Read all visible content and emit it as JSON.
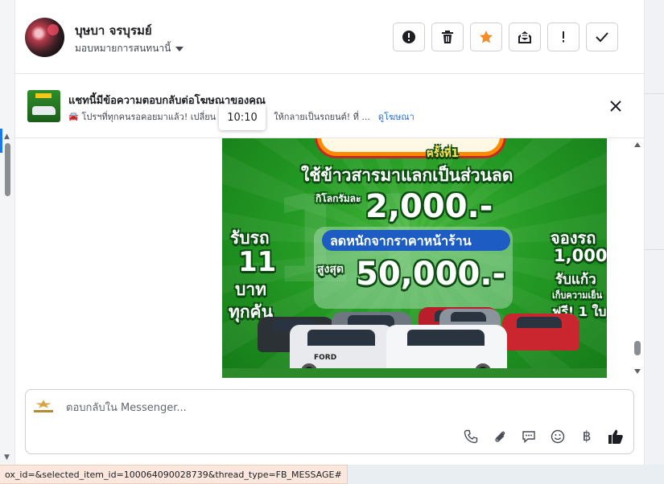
{
  "conversation": {
    "contact_name": "บุษบา จรบุรมย์",
    "assign_label": "มอบหมายการสนทนานี้"
  },
  "header_actions": [
    {
      "name": "mark-spam-button",
      "icon": "exclamation-circle-icon"
    },
    {
      "name": "delete-button",
      "icon": "trash-icon"
    },
    {
      "name": "star-button",
      "icon": "star-icon",
      "color": "#f28c28"
    },
    {
      "name": "mark-unread-button",
      "icon": "envelope-icon"
    },
    {
      "name": "follow-up-button",
      "icon": "exclamation-icon"
    },
    {
      "name": "done-button",
      "icon": "check-icon"
    }
  ],
  "ad_banner": {
    "title": "แชทนี้มีข้อความตอบกลับต่อโฆษณาของคุณ",
    "subtitle_part1": "โปรฯที่ทุกคนรอคอยมาแล้ว! เปลี่ยน",
    "subtitle_part2": "ให้กลายเป็นรถยนต์! ที่ ...",
    "link_label": "ดูโฆษณา"
  },
  "tooltip": {
    "time": "10:10"
  },
  "ad_image": {
    "line1": "ครั้งที่1",
    "line2": "ใช้ข้าวสารมาแลกเป็นส่วนลด",
    "line3": "กิโลกรัมละ",
    "amount1": "2,000.-",
    "line4": "ลดหนักจากราคาหน้าร้าน",
    "line5": "สูงสุด",
    "amount2": "50,000.-",
    "left1": "รับรถ",
    "left2": "11",
    "left3": "บาท",
    "left4": "ทุกคัน",
    "right1": "จองรถ",
    "right2": "1,000",
    "right3": "รับแก้ว",
    "right4": "เก็บความเย็น",
    "right5": "ฟรี! 1 ใบ",
    "car_brand": "FORD"
  },
  "composer": {
    "placeholder": "ตอบกลับใน Messenger...",
    "value": "",
    "tools": [
      "phone-icon",
      "paperclip-icon",
      "chat-bubble-icon",
      "emoji-icon",
      "baht-icon",
      "thumbs-up-icon"
    ],
    "baht_symbol": "฿",
    "like_color": "#1c1e21"
  },
  "status_bar": {
    "url_text": "ox_id=&selected_item_id=100064090028739&thread_type=FB_MESSAGE#"
  },
  "colors": {
    "accent": "#1877f2",
    "link": "#216fdb",
    "ad_green": "#249a24"
  }
}
